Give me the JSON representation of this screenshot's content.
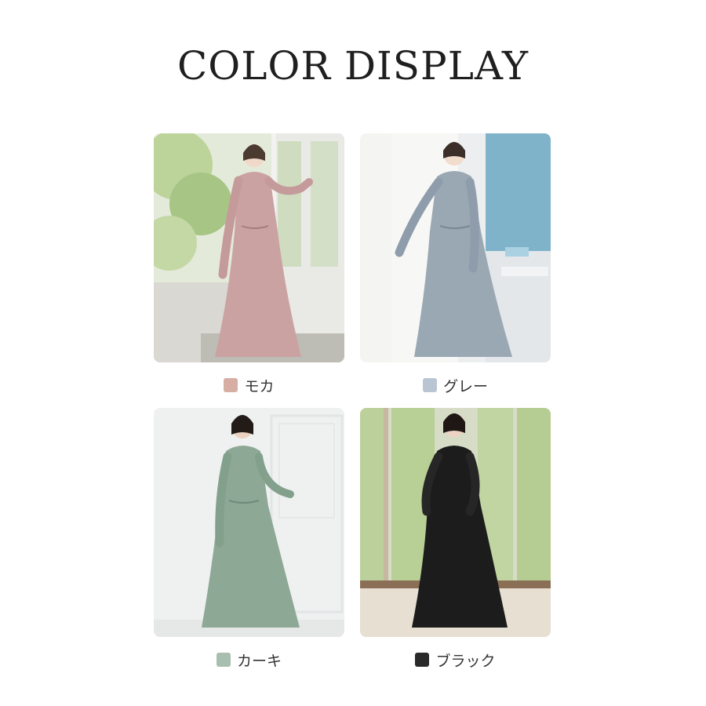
{
  "header": {
    "title": "COLOR DISPLAY"
  },
  "colors": [
    {
      "name": "モカ",
      "swatch": "#d6aea3",
      "dress": "#cba2a2",
      "background": "#dfe7d3"
    },
    {
      "name": "グレー",
      "swatch": "#b9c5d2",
      "dress": "#9aa8b4",
      "background": "#e9ecef"
    },
    {
      "name": "カーキ",
      "swatch": "#a8beb1",
      "dress": "#8ea896",
      "background": "#eef0f0"
    },
    {
      "name": "ブラック",
      "swatch": "#2a2a2a",
      "dress": "#1c1c1c",
      "background": "#d9dfc8"
    }
  ]
}
